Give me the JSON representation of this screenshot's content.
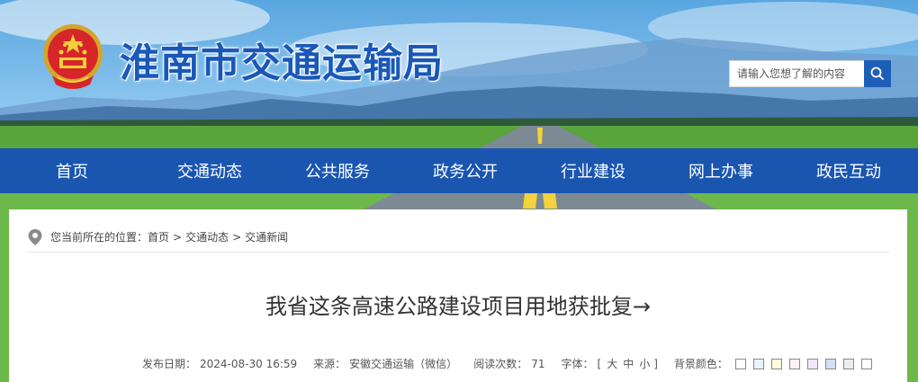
{
  "header": {
    "site_title": "淮南市交通运输局",
    "search_placeholder": "请输入您想了解的内容"
  },
  "nav": {
    "items": [
      "首页",
      "交通动态",
      "公共服务",
      "政务公开",
      "行业建设",
      "网上办事",
      "政民互动"
    ]
  },
  "breadcrumb": {
    "prefix": "您当前所在的位置：",
    "items": [
      "首页",
      "交通动态",
      "交通新闻"
    ],
    "separator": ">"
  },
  "article": {
    "title": "我省这条高速公路建设项目用地获批复→",
    "meta": {
      "date_label": "发布日期：",
      "date": "2024-08-30 16:59",
      "source_label": "来源：",
      "source": "安徽交通运输（微信）",
      "views_label": "阅读次数：",
      "views": "71",
      "font_label": "字体：",
      "font_open": "[",
      "font_large": "大",
      "font_medium": "中",
      "font_small": "小",
      "font_close": "]",
      "bg_label": "背景颜色："
    },
    "bg_colors": [
      "#ffffff",
      "#e6f4ff",
      "#fffbd8",
      "#fff0f5",
      "#f3e6ff",
      "#cfe0f7",
      "#eeeeee",
      "#ffffff"
    ]
  },
  "colors": {
    "brand": "#1a56b0",
    "title": "#1a58b8"
  }
}
